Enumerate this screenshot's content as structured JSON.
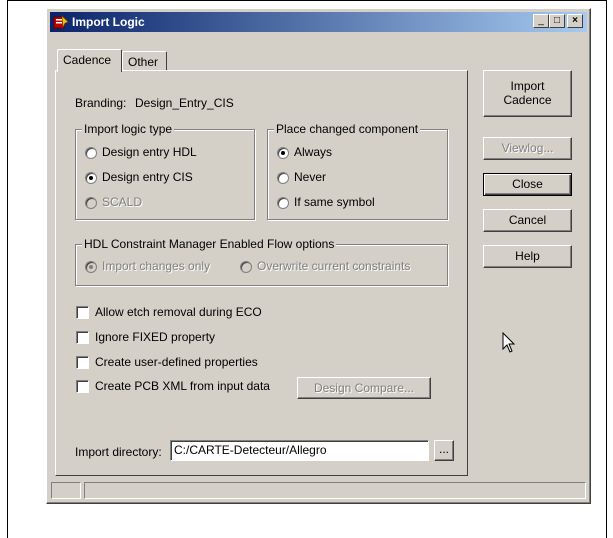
{
  "window": {
    "title": "Import Logic",
    "controls": {
      "minimize": "_",
      "maximize": "□",
      "close": "×"
    }
  },
  "tabs": [
    {
      "label": "Cadence",
      "active": true
    },
    {
      "label": "Other",
      "active": false
    }
  ],
  "branding": {
    "label": "Branding:",
    "value": "Design_Entry_CIS"
  },
  "import_logic_type": {
    "title": "Import logic type",
    "options": [
      {
        "label": "Design entry HDL",
        "selected": false,
        "enabled": true
      },
      {
        "label": "Design entry CIS",
        "selected": true,
        "enabled": true
      },
      {
        "label": "SCALD",
        "selected": false,
        "enabled": false
      }
    ]
  },
  "place_changed": {
    "title": "Place changed component",
    "options": [
      {
        "label": "Always",
        "selected": true
      },
      {
        "label": "Never",
        "selected": false
      },
      {
        "label": "If same symbol",
        "selected": false
      }
    ]
  },
  "hdl_constraint": {
    "title": "HDL Constraint Manager Enabled Flow options",
    "options": [
      {
        "label": "Import changes only",
        "selected": true
      },
      {
        "label": "Overwrite current constraints",
        "selected": false
      }
    ]
  },
  "checkboxes": [
    {
      "label": "Allow etch removal during ECO",
      "checked": false
    },
    {
      "label": "Ignore FIXED property",
      "checked": false
    },
    {
      "label": "Create user-defined properties",
      "checked": false
    },
    {
      "label": "Create PCB XML from input data",
      "checked": false
    }
  ],
  "design_compare_label": "Design Compare...",
  "import_directory": {
    "label": "Import directory:",
    "value": "C:/CARTE-Detecteur/Allegro",
    "browse_label": "..."
  },
  "buttons": {
    "import_line1": "Import",
    "import_line2": "Cadence",
    "viewlog": "Viewlog...",
    "close": "Close",
    "cancel": "Cancel",
    "help": "Help"
  }
}
